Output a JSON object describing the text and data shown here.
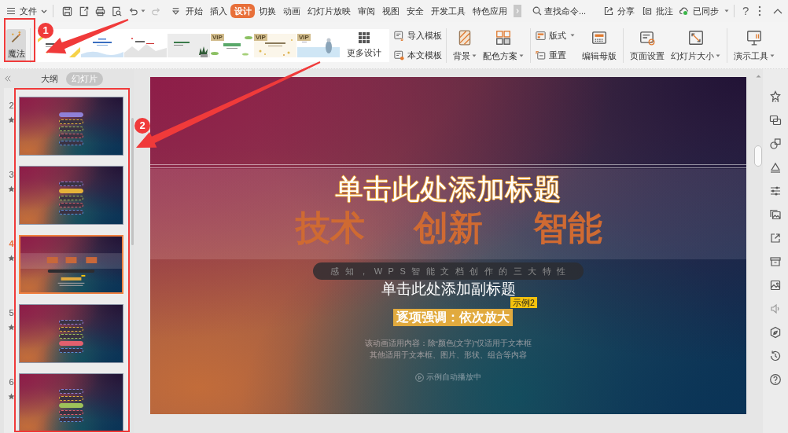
{
  "top_bar": {
    "file_menu": "文件",
    "quick_access": [
      {
        "kind": "save",
        "disabled": false,
        "dropdown": false
      },
      {
        "kind": "export",
        "disabled": false,
        "dropdown": false
      },
      {
        "kind": "print",
        "disabled": false,
        "dropdown": false
      },
      {
        "kind": "preview",
        "disabled": false,
        "dropdown": false
      },
      {
        "kind": "undo",
        "disabled": false,
        "dropdown": true
      },
      {
        "kind": "redo",
        "disabled": true,
        "dropdown": false
      },
      {
        "kind": "customize",
        "disabled": false,
        "dropdown": false
      }
    ],
    "tabs": [
      {
        "label": "开始",
        "selected": false
      },
      {
        "label": "插入",
        "selected": false
      },
      {
        "label": "设计",
        "selected": true
      },
      {
        "label": "切换",
        "selected": false
      },
      {
        "label": "动画",
        "selected": false
      },
      {
        "label": "幻灯片放映",
        "selected": false
      },
      {
        "label": "审阅",
        "selected": false
      },
      {
        "label": "视图",
        "selected": false
      },
      {
        "label": "安全",
        "selected": false
      },
      {
        "label": "开发工具",
        "selected": false
      },
      {
        "label": "特色应用",
        "selected": false
      }
    ],
    "search": {
      "placeholder": "查找命令..."
    },
    "actions": [
      {
        "kind": "share",
        "label": "分享",
        "dropdown": false
      },
      {
        "kind": "comment",
        "label": "批注",
        "dropdown": false
      },
      {
        "kind": "sync",
        "label": "已同步",
        "dropdown": true
      }
    ],
    "help": "?"
  },
  "ribbon": {
    "magic": {
      "label": "魔法",
      "active": true
    },
    "templates": [
      {
        "selected": false
      },
      {
        "selected": false
      },
      {
        "selected": false
      },
      {
        "selected": false
      },
      {
        "selected": false,
        "badge": "VIP"
      },
      {
        "selected": false,
        "badge": "VIP"
      },
      {
        "selected": false,
        "badge": "VIP"
      }
    ],
    "more_designs": "更多设计",
    "groups": [
      [
        {
          "kind": "stack",
          "buttons": [
            {
              "kind": "import",
              "label": "导入模板",
              "dropdown": false
            },
            {
              "kind": "template",
              "label": "本文模板",
              "dropdown": false
            }
          ]
        }
      ],
      [
        {
          "kind": "large",
          "buttons": [
            {
              "kind": "background",
              "label": "背景",
              "dropdown": true
            },
            {
              "kind": "colors",
              "label": "配色方案",
              "dropdown": true
            }
          ]
        }
      ],
      [
        {
          "kind": "stack",
          "buttons": [
            {
              "kind": "layout",
              "label": "版式",
              "dropdown": true
            },
            {
              "kind": "reset",
              "label": "重置",
              "dropdown": false
            }
          ]
        },
        {
          "kind": "large",
          "buttons": [
            {
              "kind": "master",
              "label": "编辑母版",
              "dropdown": false
            }
          ]
        }
      ],
      [
        {
          "kind": "large",
          "buttons": [
            {
              "kind": "pagesetup",
              "label": "页面设置",
              "dropdown": false
            },
            {
              "kind": "slidesize",
              "label": "幻灯片大小",
              "dropdown": true
            }
          ]
        }
      ],
      [
        {
          "kind": "large",
          "buttons": [
            {
              "kind": "tools",
              "label": "演示工具",
              "dropdown": true
            }
          ]
        }
      ]
    ]
  },
  "slide_panel": {
    "tabs": [
      {
        "label": "大纲",
        "selected": false
      },
      {
        "label": "幻灯片",
        "selected": true
      }
    ],
    "slides": [
      {
        "number": "2",
        "selected": false,
        "animated": true,
        "kind": "menu",
        "pills": [
          {
            "color": "#8f80d6",
            "filled": true
          },
          {
            "color": "#e6b23a",
            "filled": false
          },
          {
            "color": "#9dc25a",
            "filled": false
          },
          {
            "color": "#e2606e",
            "filled": false
          },
          {
            "color": "#5a8ed8",
            "filled": false
          }
        ]
      },
      {
        "number": "3",
        "selected": false,
        "animated": true,
        "kind": "menu",
        "pills": [
          {
            "color": "#8f80d6",
            "filled": false
          },
          {
            "color": "#e6b23a",
            "filled": true
          },
          {
            "color": "#9dc25a",
            "filled": false
          },
          {
            "color": "#e2606e",
            "filled": false
          },
          {
            "color": "#5a8ed8",
            "filled": false
          }
        ]
      },
      {
        "number": "4",
        "selected": true,
        "animated": true,
        "kind": "title"
      },
      {
        "number": "5",
        "selected": false,
        "animated": true,
        "kind": "menu",
        "pills": [
          {
            "color": "#8f80d6",
            "filled": false
          },
          {
            "color": "#e6b23a",
            "filled": false
          },
          {
            "color": "#9dc25a",
            "filled": false
          },
          {
            "color": "#e2606e",
            "filled": true
          },
          {
            "color": "#5a8ed8",
            "filled": false
          }
        ]
      },
      {
        "number": "6",
        "selected": false,
        "animated": true,
        "kind": "menu",
        "pills": [
          {
            "color": "#8f80d6",
            "filled": false
          },
          {
            "color": "#e6b23a",
            "filled": false
          },
          {
            "color": "#9dc25a",
            "filled": true
          },
          {
            "color": "#e2606e",
            "filled": false
          },
          {
            "color": "#5a8ed8",
            "filled": false
          }
        ]
      }
    ]
  },
  "slide": {
    "background_words": [
      "技术",
      "创新",
      "智能"
    ],
    "title": "单击此处添加标题",
    "tagline": "感知，WPS智能文档创作的三大特性",
    "subtitle": "单击此处添加副标题",
    "emphasis": "逐项强调：依次放大",
    "example_tag": "示例2",
    "notes": [
      "该动画适用内容：除“颜色(文字)”仅适用于文本框",
      "其他适用于文本框、图片、形状、组合等内容"
    ],
    "playback": "示例自动播放中"
  },
  "annotations": [
    {
      "label": "1"
    },
    {
      "label": "2"
    }
  ]
}
